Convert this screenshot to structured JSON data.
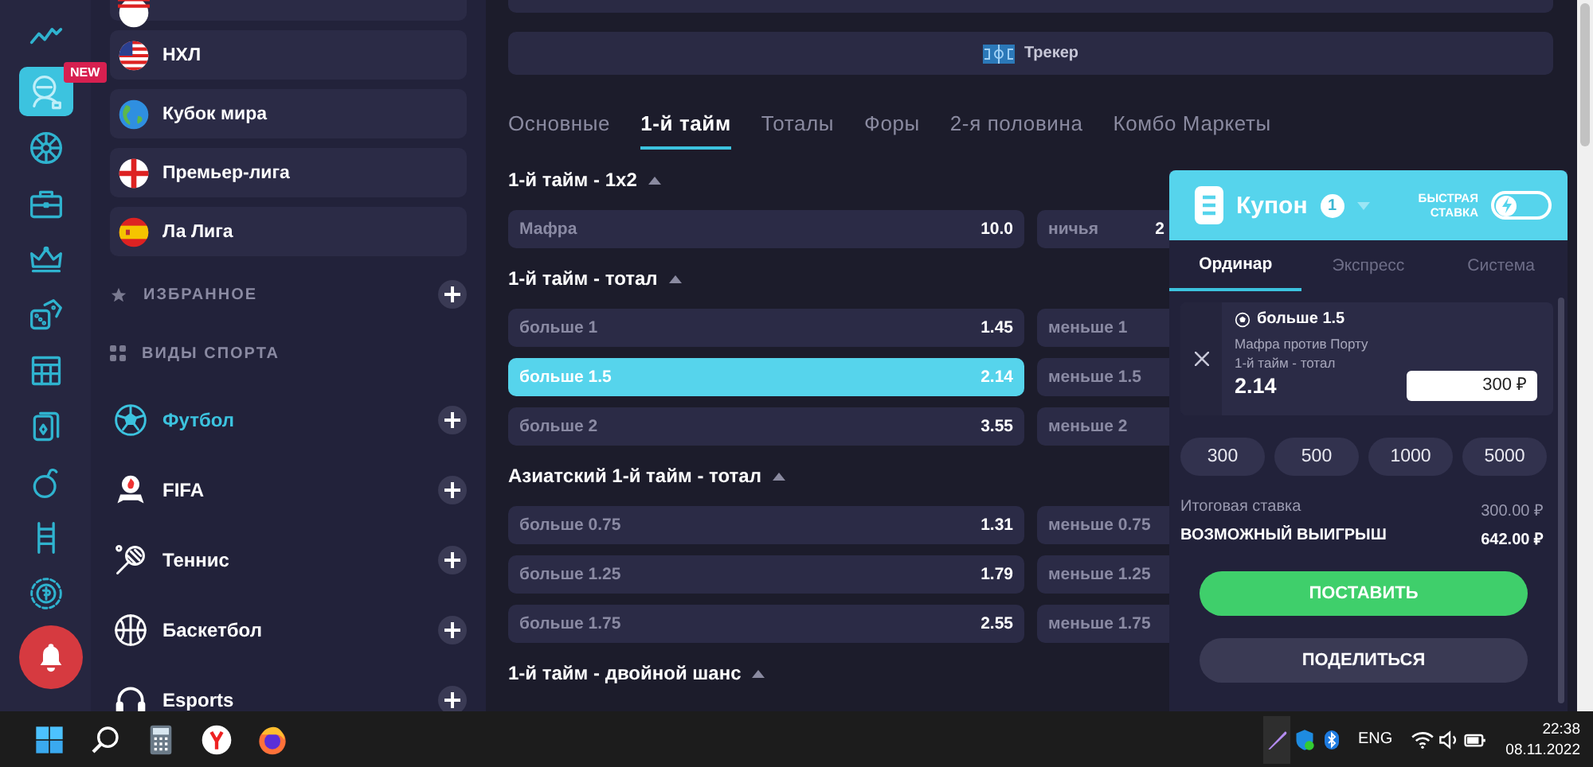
{
  "rail": {
    "items": [
      {
        "selected": false
      },
      {
        "selected": true,
        "badge": "NEW"
      },
      {
        "selected": false
      },
      {
        "selected": false
      },
      {
        "selected": false
      },
      {
        "selected": false
      },
      {
        "selected": false
      },
      {
        "selected": false
      },
      {
        "selected": false
      },
      {
        "selected": false
      },
      {
        "selected": false
      }
    ]
  },
  "sidebar": {
    "leagues": [
      {
        "name": "НХЛ"
      },
      {
        "name": "Кубок мира"
      },
      {
        "name": "Премьер-лига"
      },
      {
        "name": "Ла Лига"
      }
    ],
    "favorites": {
      "label": "ИЗБРАННОЕ"
    },
    "sports_heading": {
      "label": "ВИДЫ СПОРТА"
    },
    "sports": [
      {
        "name": "Футбол",
        "selected": true
      },
      {
        "name": "FIFA",
        "selected": false
      },
      {
        "name": "Теннис",
        "selected": false
      },
      {
        "name": "Баскетбол",
        "selected": false
      },
      {
        "name": "Esports",
        "selected": false
      }
    ]
  },
  "main": {
    "tracker": {
      "label": "Трекер"
    },
    "tabs": [
      {
        "label": "Основные",
        "selected": false
      },
      {
        "label": "1-й тайм",
        "selected": true
      },
      {
        "label": "Тоталы",
        "selected": false
      },
      {
        "label": "Форы",
        "selected": false
      },
      {
        "label": "2-я половина",
        "selected": false
      },
      {
        "label": "Комбо Маркеты",
        "selected": false
      }
    ],
    "markets": [
      {
        "title": "1-й тайм - 1x2",
        "expanded": true,
        "rows": [
          [
            {
              "label": "Мафра",
              "odds": "10.0",
              "selected": false
            },
            {
              "label": "ничья",
              "odds": "2",
              "selected": false
            }
          ]
        ]
      },
      {
        "title": "1-й тайм - тотал",
        "expanded": true,
        "rows": [
          [
            {
              "label": "больше 1",
              "odds": "1.45",
              "selected": false
            },
            {
              "label": "меньше 1",
              "selected": false
            }
          ],
          [
            {
              "label": "больше 1.5",
              "odds": "2.14",
              "selected": true
            },
            {
              "label": "меньше 1.5",
              "selected": false
            }
          ],
          [
            {
              "label": "больше 2",
              "odds": "3.55",
              "selected": false
            },
            {
              "label": "меньше 2",
              "selected": false
            }
          ]
        ]
      },
      {
        "title": "Азиатский 1-й тайм - тотал",
        "expanded": true,
        "rows": [
          [
            {
              "label": "больше 0.75",
              "odds": "1.31",
              "selected": false
            },
            {
              "label": "меньше 0.75",
              "selected": false
            }
          ],
          [
            {
              "label": "больше 1.25",
              "odds": "1.79",
              "selected": false
            },
            {
              "label": "меньше 1.25",
              "selected": false
            }
          ],
          [
            {
              "label": "больше 1.75",
              "odds": "2.55",
              "selected": false
            },
            {
              "label": "меньше 1.75",
              "selected": false
            }
          ]
        ]
      },
      {
        "title": "1-й тайм - двойной шанс",
        "expanded": true
      }
    ]
  },
  "coupon": {
    "title": "Купон",
    "count": "1",
    "fast_bet": {
      "label": "БЫСТРАЯ СТАВКА",
      "on": false
    },
    "tabs": [
      {
        "label": "Ординар",
        "selected": true
      },
      {
        "label": "Экспресс",
        "selected": false
      },
      {
        "label": "Система",
        "selected": false
      }
    ],
    "bet": {
      "selection": "больше 1.5",
      "match": "Мафра против Порту",
      "market": "1-й тайм - тотал",
      "odds": "2.14",
      "stake": "300 ₽"
    },
    "chips": [
      "300",
      "500",
      "1000",
      "5000"
    ],
    "total_label": "Итоговая ставка",
    "total_value": "300.00 ₽",
    "win_label": "ВОЗМОЖНЫЙ ВЫИГРЫШ",
    "win_value": "642.00 ₽",
    "place_button": "ПОСТАВИТЬ",
    "share_button": "ПОДЕЛИТЬСЯ"
  },
  "taskbar": {
    "language": "ENG",
    "time": "22:38",
    "date": "08.11.2022"
  }
}
